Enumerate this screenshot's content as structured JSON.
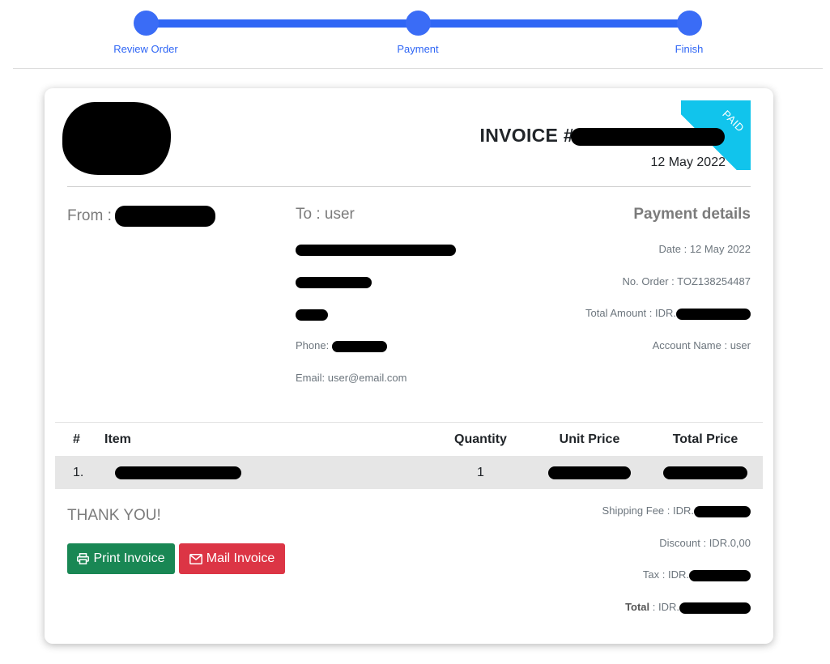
{
  "stepper": {
    "steps": [
      {
        "label": "Review Order"
      },
      {
        "label": "Payment"
      },
      {
        "label": "Finish"
      }
    ],
    "color": "#2f66f5"
  },
  "invoice": {
    "title_prefix": "INVOICE #",
    "date": "12 May 2022",
    "status_ribbon": "PAID",
    "ribbon_color": "#11c4ec"
  },
  "from": {
    "label": "From :"
  },
  "to": {
    "label": "To : user",
    "phone_label": "Phone:",
    "email": "Email: user@email.com"
  },
  "payment_details": {
    "title": "Payment details",
    "date": "Date : 12 May 2022",
    "order_no": "No. Order : TOZ138254487",
    "total_amount_label": "Total Amount : IDR.",
    "account_name": "Account Name : user"
  },
  "table": {
    "headers": [
      "#",
      "Item",
      "Quantity",
      "Unit Price",
      "Total Price"
    ],
    "rows": [
      {
        "num": "1.",
        "quantity": "1"
      }
    ]
  },
  "footer": {
    "thank_you": "THANK YOU!",
    "print_label": "Print Invoice",
    "mail_label": "Mail Invoice",
    "shipping_label": "Shipping Fee : IDR.",
    "discount": "Discount : IDR.0,00",
    "tax_label": "Tax : IDR.",
    "total_label": "Total",
    "total_suffix": " : IDR."
  },
  "colors": {
    "print_button": "#198754",
    "mail_button": "#dc3545"
  }
}
